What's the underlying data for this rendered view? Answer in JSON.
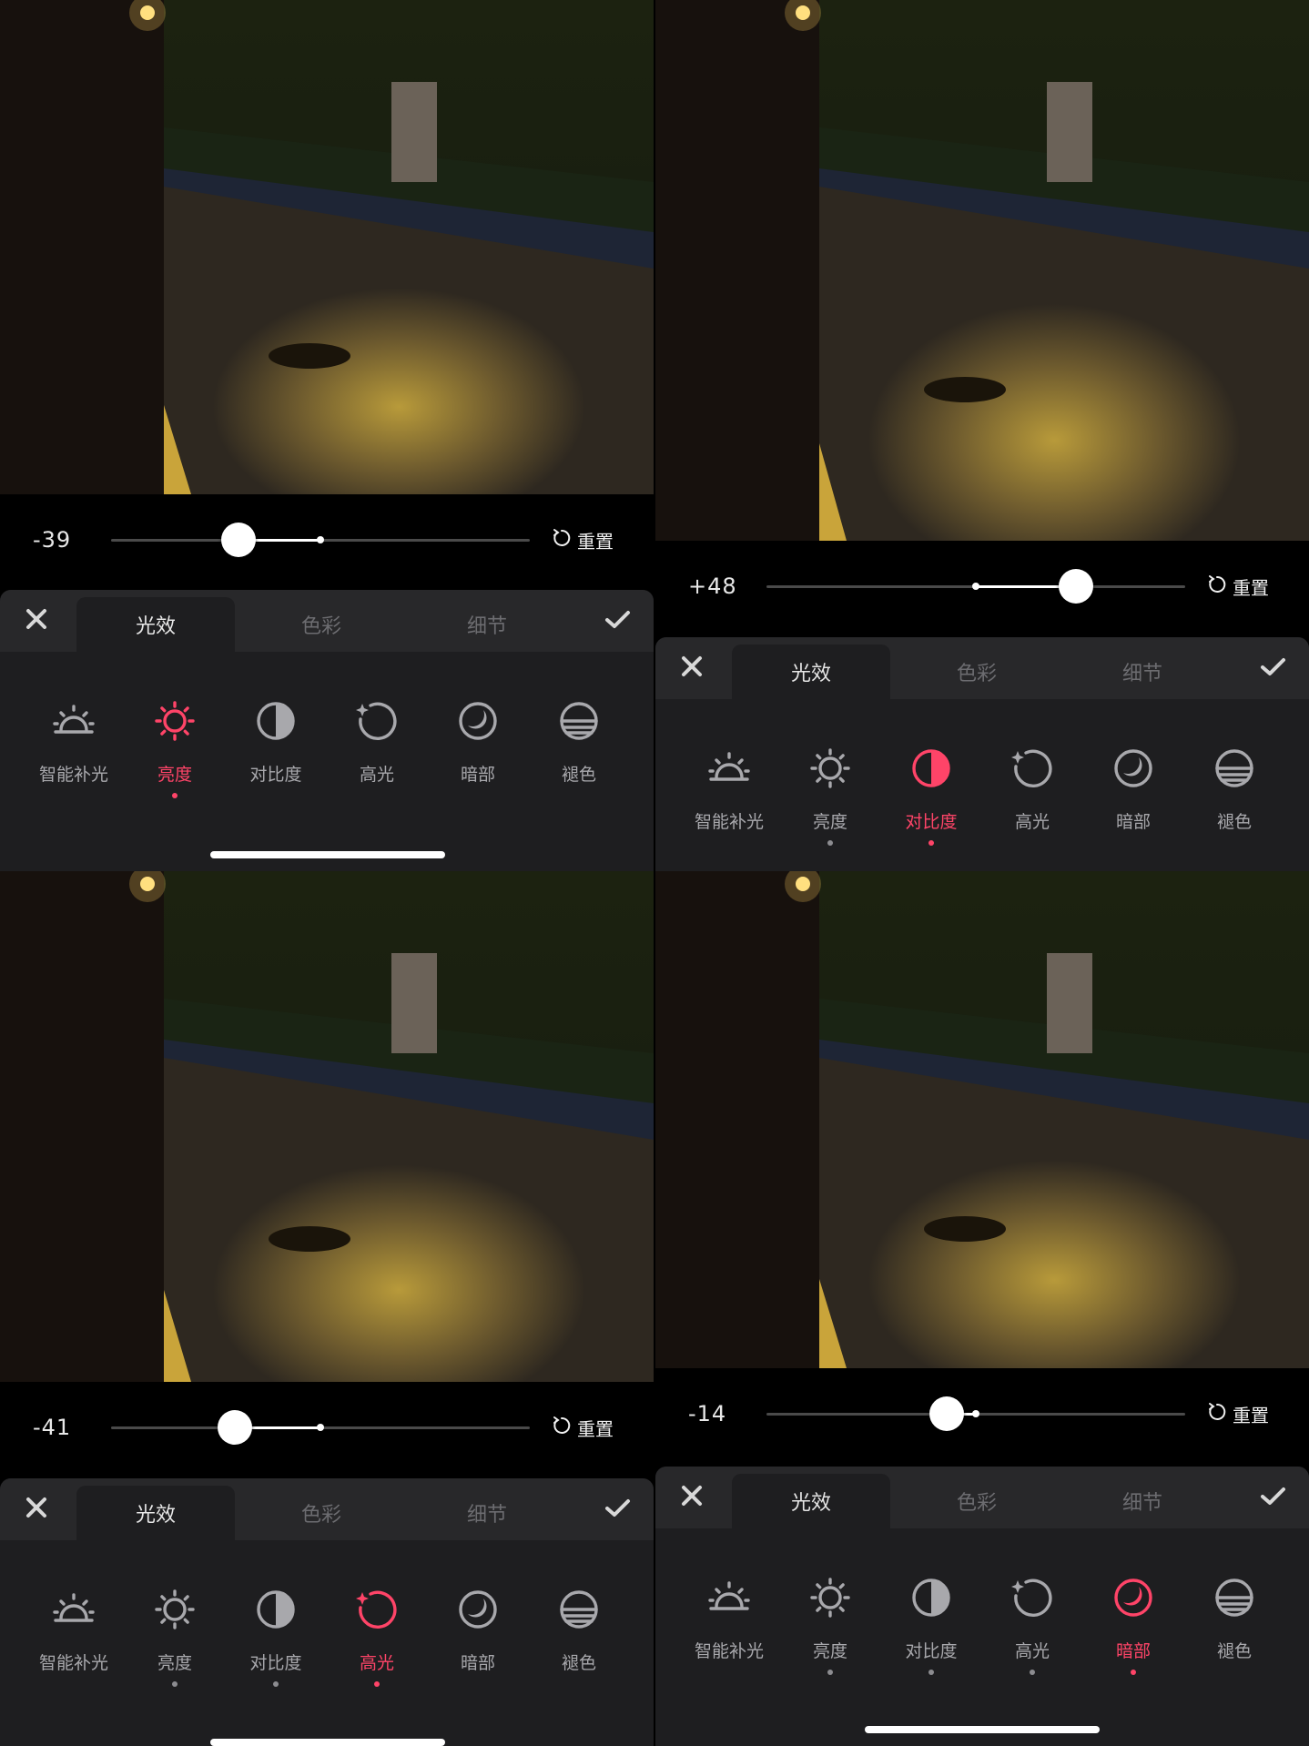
{
  "colors": {
    "accent": "#ff4468",
    "idle": "#a8a8ac",
    "background": "#000000",
    "panel": "#1e1e20"
  },
  "panels": [
    {
      "slider": {
        "value_label": "-39",
        "value": -39,
        "min": -100,
        "max": 100
      },
      "reset_label": "重置",
      "tabs": [
        "光效",
        "色彩",
        "细节"
      ],
      "active_tab": 0,
      "tools": [
        {
          "label": "智能补光",
          "icon": "sunrise-icon",
          "active": false,
          "visited": false
        },
        {
          "label": "亮度",
          "icon": "sun-icon",
          "active": true,
          "visited": false
        },
        {
          "label": "对比度",
          "icon": "contrast-icon",
          "active": false,
          "visited": false
        },
        {
          "label": "高光",
          "icon": "highlight-icon",
          "active": false,
          "visited": false
        },
        {
          "label": "暗部",
          "icon": "moon-icon",
          "active": false,
          "visited": false
        },
        {
          "label": "褪色",
          "icon": "fade-icon",
          "active": false,
          "visited": false
        }
      ]
    },
    {
      "slider": {
        "value_label": "+48",
        "value": 48,
        "min": -100,
        "max": 100
      },
      "reset_label": "重置",
      "tabs": [
        "光效",
        "色彩",
        "细节"
      ],
      "active_tab": 0,
      "tools": [
        {
          "label": "智能补光",
          "icon": "sunrise-icon",
          "active": false,
          "visited": false
        },
        {
          "label": "亮度",
          "icon": "sun-icon",
          "active": false,
          "visited": true
        },
        {
          "label": "对比度",
          "icon": "contrast-icon",
          "active": true,
          "visited": false
        },
        {
          "label": "高光",
          "icon": "highlight-icon",
          "active": false,
          "visited": false
        },
        {
          "label": "暗部",
          "icon": "moon-icon",
          "active": false,
          "visited": false
        },
        {
          "label": "褪色",
          "icon": "fade-icon",
          "active": false,
          "visited": false
        }
      ]
    },
    {
      "slider": {
        "value_label": "-41",
        "value": -41,
        "min": -100,
        "max": 100
      },
      "reset_label": "重置",
      "tabs": [
        "光效",
        "色彩",
        "细节"
      ],
      "active_tab": 0,
      "tools": [
        {
          "label": "智能补光",
          "icon": "sunrise-icon",
          "active": false,
          "visited": false
        },
        {
          "label": "亮度",
          "icon": "sun-icon",
          "active": false,
          "visited": true
        },
        {
          "label": "对比度",
          "icon": "contrast-icon",
          "active": false,
          "visited": true
        },
        {
          "label": "高光",
          "icon": "highlight-icon",
          "active": true,
          "visited": false
        },
        {
          "label": "暗部",
          "icon": "moon-icon",
          "active": false,
          "visited": false
        },
        {
          "label": "褪色",
          "icon": "fade-icon",
          "active": false,
          "visited": false
        }
      ]
    },
    {
      "slider": {
        "value_label": "-14",
        "value": -14,
        "min": -100,
        "max": 100
      },
      "reset_label": "重置",
      "tabs": [
        "光效",
        "色彩",
        "细节"
      ],
      "active_tab": 0,
      "tools": [
        {
          "label": "智能补光",
          "icon": "sunrise-icon",
          "active": false,
          "visited": false
        },
        {
          "label": "亮度",
          "icon": "sun-icon",
          "active": false,
          "visited": true
        },
        {
          "label": "对比度",
          "icon": "contrast-icon",
          "active": false,
          "visited": true
        },
        {
          "label": "高光",
          "icon": "highlight-icon",
          "active": false,
          "visited": true
        },
        {
          "label": "暗部",
          "icon": "moon-icon",
          "active": true,
          "visited": false
        },
        {
          "label": "褪色",
          "icon": "fade-icon",
          "active": false,
          "visited": false
        }
      ]
    }
  ]
}
